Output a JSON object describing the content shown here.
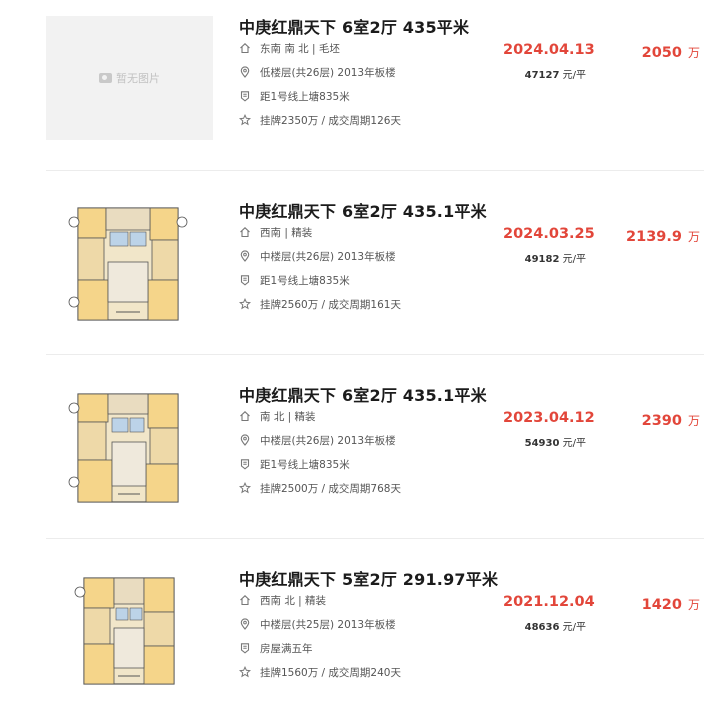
{
  "placeholder_text": "暂无图片",
  "listings": [
    {
      "title": "中庚红鼎天下 6室2厅 435平米",
      "house_info": "东南 南 北 | 毛坯",
      "floor_info": "低楼层(共26层) 2013年板楼",
      "tag_info": "距1号线上塘835米",
      "listing_info": "挂牌2350万 / 成交周期126天",
      "deal_date": "2024.04.13",
      "unit_price": "47127",
      "unit_price_suffix": "元/平",
      "total_price": "2050",
      "total_unit": "万",
      "has_image": false
    },
    {
      "title": "中庚红鼎天下 6室2厅 435.1平米",
      "house_info": "西南 | 精装",
      "floor_info": "中楼层(共26层) 2013年板楼",
      "tag_info": "距1号线上塘835米",
      "listing_info": "挂牌2560万 / 成交周期161天",
      "deal_date": "2024.03.25",
      "unit_price": "49182",
      "unit_price_suffix": "元/平",
      "total_price": "2139.9",
      "total_unit": "万",
      "has_image": true
    },
    {
      "title": "中庚红鼎天下 6室2厅 435.1平米",
      "house_info": "南 北 | 精装",
      "floor_info": "中楼层(共26层) 2013年板楼",
      "tag_info": "距1号线上塘835米",
      "listing_info": "挂牌2500万 / 成交周期768天",
      "deal_date": "2023.04.12",
      "unit_price": "54930",
      "unit_price_suffix": "元/平",
      "total_price": "2390",
      "total_unit": "万",
      "has_image": true
    },
    {
      "title": "中庚红鼎天下 5室2厅 291.97平米",
      "house_info": "西南 北 | 精装",
      "floor_info": "中楼层(共25层) 2013年板楼",
      "tag_info": "房屋满五年",
      "listing_info": "挂牌1560万 / 成交周期240天",
      "deal_date": "2021.12.04",
      "unit_price": "48636",
      "unit_price_suffix": "元/平",
      "total_price": "1420",
      "total_unit": "万",
      "has_image": true
    }
  ],
  "icons": {
    "house_info": "house-icon",
    "floor_info": "location-pin-icon",
    "tag_info": "shield-tag-icon",
    "listing_info": "star-icon"
  },
  "colors": {
    "accent_red": "#e2463a",
    "title": "#1b1b1b",
    "divider": "#ececec",
    "placeholder_bg": "#f2f2f2"
  }
}
